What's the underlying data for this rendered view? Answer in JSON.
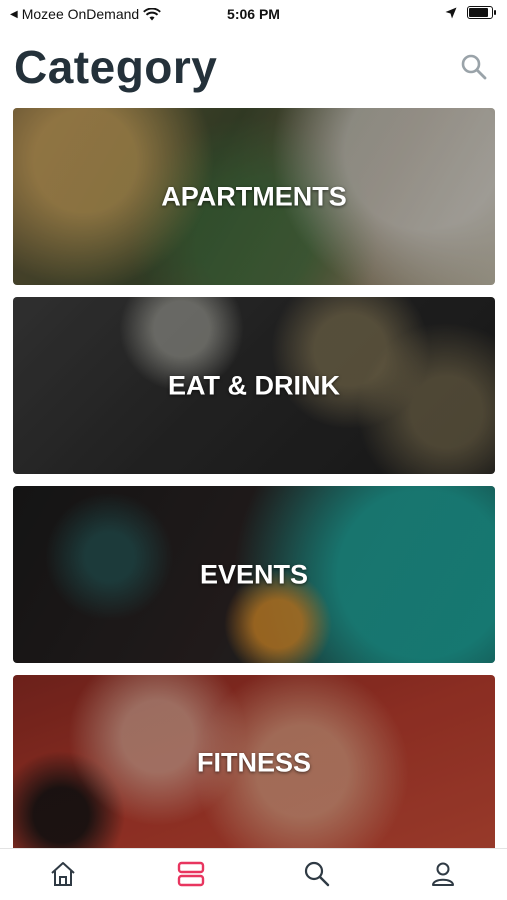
{
  "status_bar": {
    "carrier": "Mozee OnDemand",
    "time": "5:06 PM"
  },
  "header": {
    "title": "Category",
    "search_icon": "search-icon"
  },
  "categories": [
    {
      "label": "APARTMENTS"
    },
    {
      "label": "EAT & DRINK"
    },
    {
      "label": "EVENTS"
    },
    {
      "label": "FITNESS"
    }
  ],
  "tab_bar": {
    "items": [
      {
        "icon": "home-icon",
        "active": false
      },
      {
        "icon": "category-icon",
        "active": true
      },
      {
        "icon": "search-icon",
        "active": false
      },
      {
        "icon": "profile-icon",
        "active": false
      }
    ]
  },
  "colors": {
    "title": "#24313a",
    "tab_inactive": "#2f3a44",
    "tab_active": "#e8355f",
    "search_icon": "#9aa3a9"
  }
}
